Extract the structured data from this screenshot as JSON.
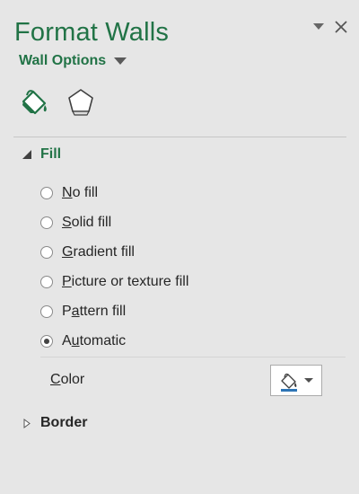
{
  "pane": {
    "title": "Format Walls",
    "options_dropdown_label": "Wall Options"
  },
  "tabs": [
    {
      "name": "Fill & Line",
      "icon": "paint-bucket-icon",
      "selected": true
    },
    {
      "name": "Effects",
      "icon": "pentagon-icon",
      "selected": false
    }
  ],
  "fill_section": {
    "label": "Fill",
    "expanded": true,
    "options": [
      {
        "accel": "N",
        "rest": "o fill",
        "checked": false
      },
      {
        "accel": "S",
        "rest": "olid fill",
        "checked": false
      },
      {
        "accel": "G",
        "rest": "radient fill",
        "checked": false
      },
      {
        "accel": "P",
        "rest": "icture or texture fill",
        "checked": false
      },
      {
        "pre": "P",
        "accel": "a",
        "rest": "ttern fill",
        "checked": false
      },
      {
        "pre": "A",
        "accel": "u",
        "rest": "tomatic",
        "checked": true
      }
    ],
    "color": {
      "accel": "C",
      "rest": "olor",
      "picker_icon": "paint-bucket-icon"
    }
  },
  "border_section": {
    "label": "Border",
    "expanded": false
  },
  "colors": {
    "accent": "#217346",
    "background": "#e6e6e6",
    "text": "#262626"
  }
}
